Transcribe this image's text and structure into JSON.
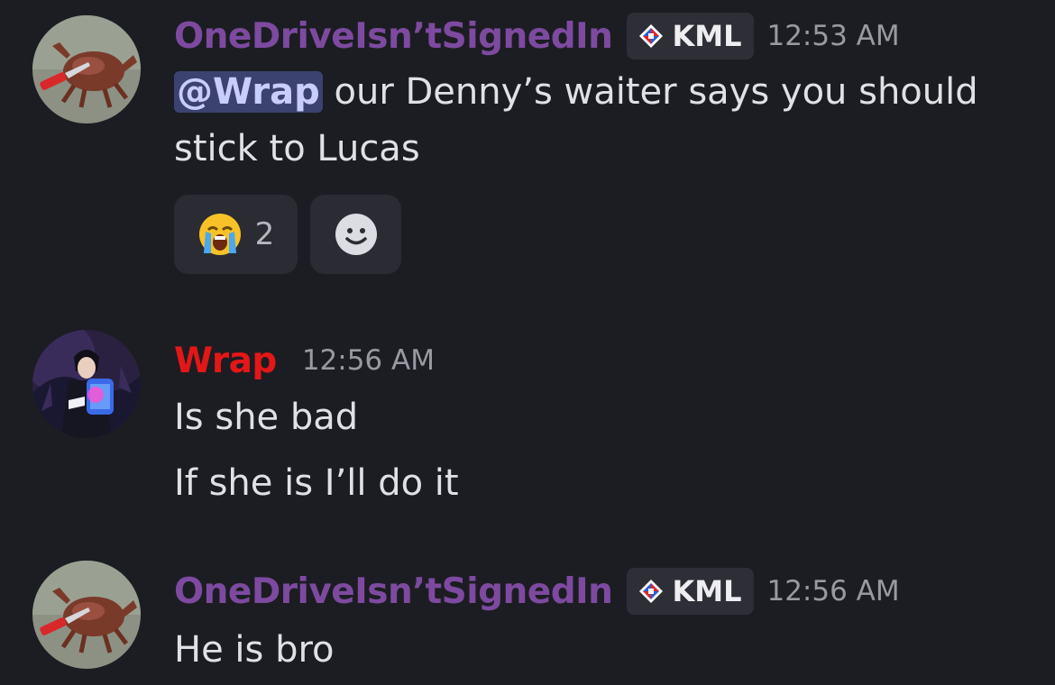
{
  "colors": {
    "background": "#1c1d22",
    "onedrive_name": "#7d4aa0",
    "wrap_name": "#e31717",
    "mention_bg": "#3c4270",
    "mention_text": "#c9cdfb"
  },
  "messages": [
    {
      "author": "OneDriveIsn’tSignedIn",
      "tag": "KML",
      "time": "12:53 AM",
      "avatar": "crab-with-knife-avatar",
      "mention": "@Wrap",
      "line1_rest": " our Denny’s waiter says you should",
      "line2": "stick to Lucas",
      "reactions": [
        {
          "emoji": "loudly-crying-face-icon",
          "count": "2"
        },
        {
          "emoji": "add-reaction-icon",
          "count": ""
        }
      ]
    },
    {
      "author": "Wrap",
      "time": "12:56 AM",
      "avatar": "anime-character-avatar",
      "lines": [
        "Is she bad",
        "If she is I’ll do it"
      ]
    },
    {
      "author": "OneDriveIsn’tSignedIn",
      "tag": "KML",
      "time": "12:56 AM",
      "avatar": "crab-with-knife-avatar",
      "lines": [
        "He is bro"
      ]
    }
  ]
}
